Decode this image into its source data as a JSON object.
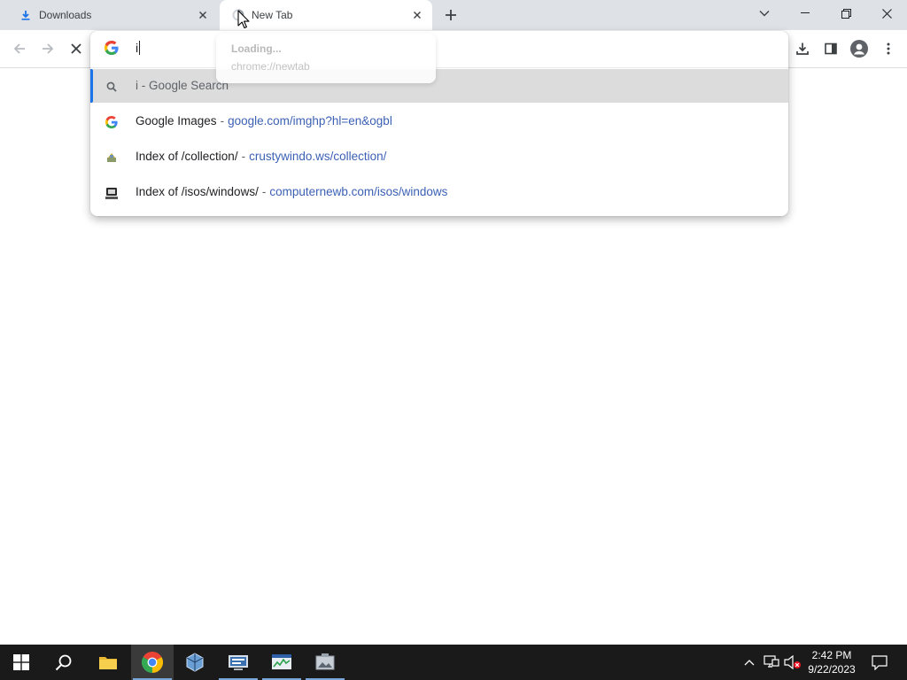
{
  "browser": {
    "tabs": [
      {
        "title": "Downloads",
        "icon": "download-icon",
        "active": false
      },
      {
        "title": "New Tab",
        "icon": "loading-spinner-icon",
        "active": true
      }
    ],
    "tab_tooltip": {
      "title": "Loading...",
      "url": "chrome://newtab"
    }
  },
  "omnibox": {
    "input_value": "i",
    "suggestions": [
      {
        "icon": "search-icon",
        "title": "i - Google Search",
        "url": "",
        "selected": true
      },
      {
        "icon": "google-icon",
        "title": "Google Images",
        "url": "google.com/imghp?hl=en&ogbl",
        "selected": false
      },
      {
        "icon": "favicon-collection-icon",
        "title": "Index of /collection/",
        "url": "crustywindo.ws/collection/",
        "selected": false
      },
      {
        "icon": "favicon-computernewb-icon",
        "title": "Index of /isos/windows/",
        "url": "computernewb.com/isos/windows",
        "selected": false
      }
    ],
    "separator": "-"
  },
  "taskbar": {
    "apps": [
      "start-icon",
      "search-icon",
      "file-explorer-icon",
      "chrome-icon",
      "virtualbox-icon",
      "network-app-icon",
      "task-manager-icon",
      "photo-app-icon"
    ],
    "clock": {
      "time": "2:42 PM",
      "date": "9/22/2023"
    }
  },
  "colors": {
    "tabstrip": "#dee1e6",
    "selected_suggestion": "#dcdcdc",
    "accent": "#1a73e8",
    "url_text": "#3c61b4",
    "taskbar": "#1a1a1a"
  }
}
